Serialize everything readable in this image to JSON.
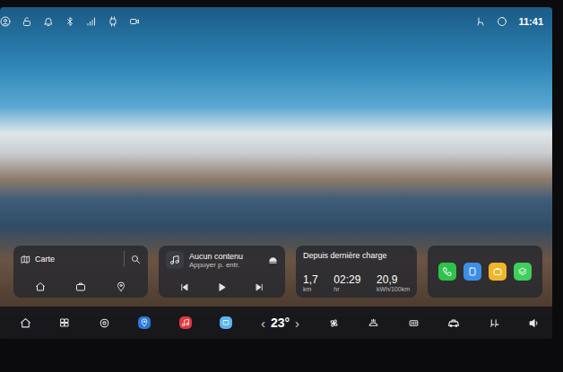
{
  "status_bar": {
    "time": "11:41"
  },
  "map_widget": {
    "title": "Carte"
  },
  "media_widget": {
    "title": "Aucun contenu",
    "subtitle": "Appuyer p. entr."
  },
  "trip_widget": {
    "title": "Depuis dernière charge",
    "stats": [
      {
        "value": "1,7",
        "unit": "km"
      },
      {
        "value": "02:29",
        "unit": "hr"
      },
      {
        "value": "20,9",
        "unit": "kWh/100km"
      }
    ]
  },
  "apps": [
    {
      "color": "#2fc24a"
    },
    {
      "color": "#3d8fe6"
    },
    {
      "color": "#f0b52a"
    },
    {
      "color": "#3fcf5a"
    }
  ],
  "dock": {
    "prev": "‹",
    "temperature": "23°",
    "next": "›"
  }
}
